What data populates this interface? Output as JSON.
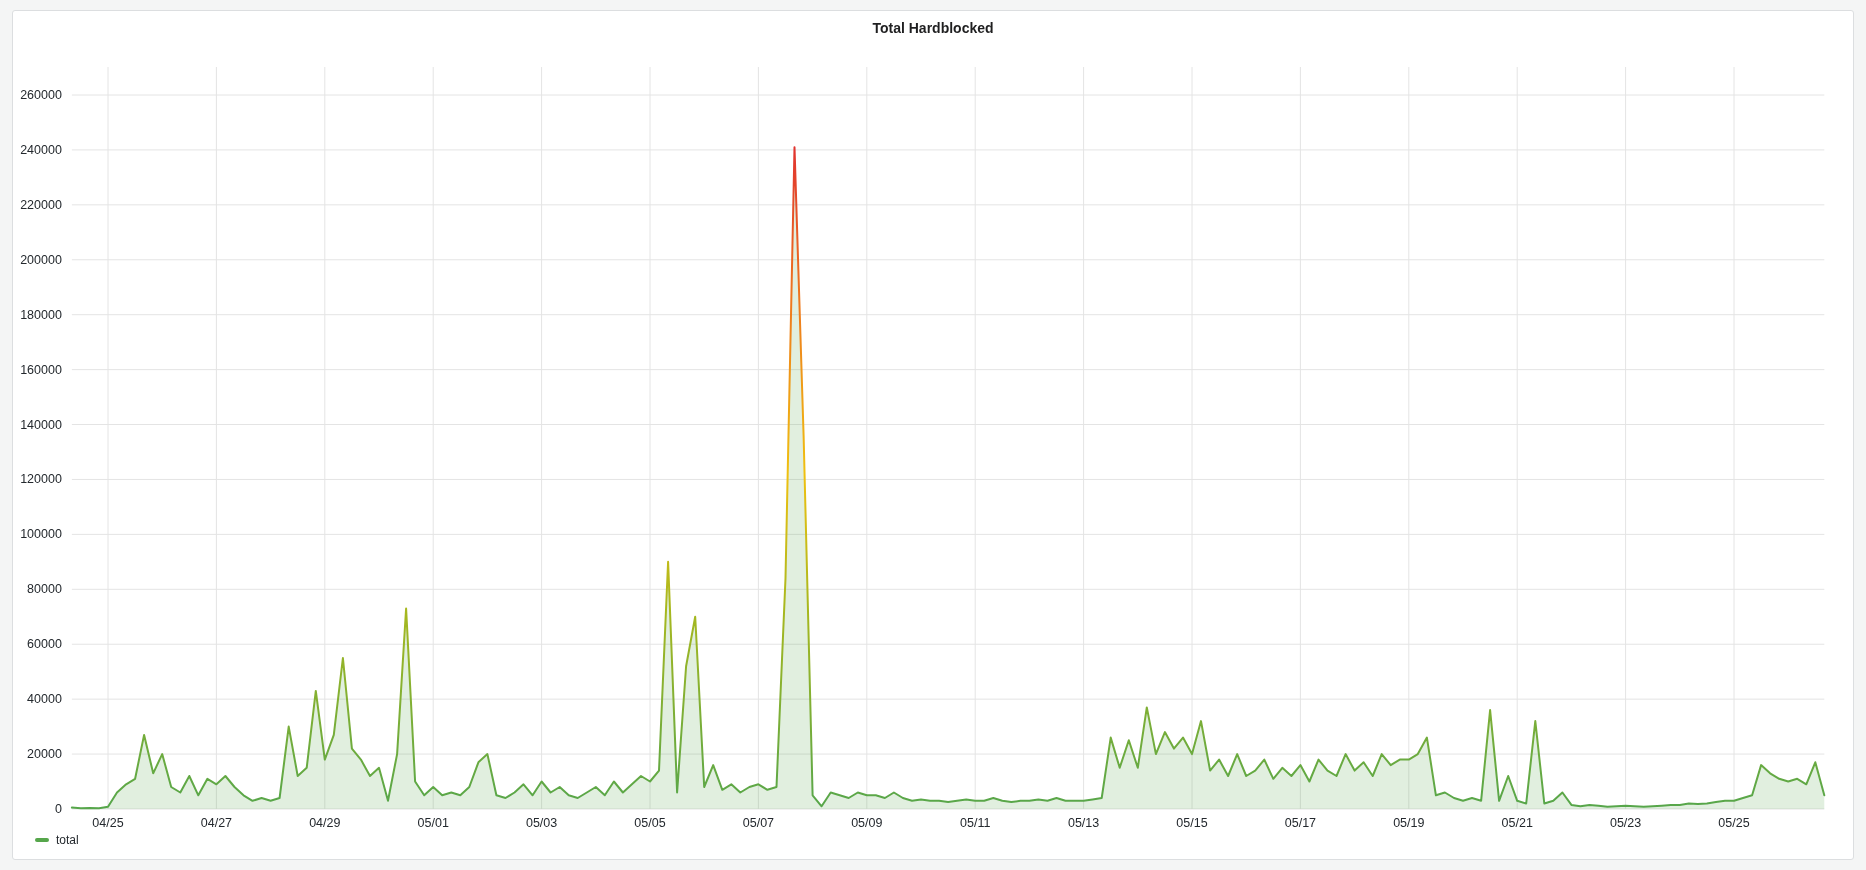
{
  "panel": {
    "title": "Total Hardblocked",
    "chart_data": {
      "type": "area",
      "grid": true,
      "ylim": [
        0,
        260000
      ],
      "yticks": [
        0,
        20000,
        40000,
        60000,
        80000,
        100000,
        120000,
        140000,
        160000,
        180000,
        200000,
        220000,
        240000,
        260000
      ],
      "categories": [
        null,
        null,
        null,
        null,
        "04/25",
        null,
        null,
        null,
        null,
        null,
        null,
        null,
        null,
        null,
        null,
        null,
        "04/27",
        null,
        null,
        null,
        null,
        null,
        null,
        null,
        null,
        null,
        null,
        null,
        "04/29",
        null,
        null,
        null,
        null,
        null,
        null,
        null,
        null,
        null,
        null,
        null,
        "05/01",
        null,
        null,
        null,
        null,
        null,
        null,
        null,
        null,
        null,
        null,
        null,
        "05/03",
        null,
        null,
        null,
        null,
        null,
        null,
        null,
        null,
        null,
        null,
        null,
        "05/05",
        null,
        null,
        null,
        null,
        null,
        null,
        null,
        null,
        null,
        null,
        null,
        "05/07",
        null,
        null,
        null,
        null,
        null,
        null,
        null,
        null,
        null,
        null,
        null,
        "05/09",
        null,
        null,
        null,
        null,
        null,
        null,
        null,
        null,
        null,
        null,
        null,
        "05/11",
        null,
        null,
        null,
        null,
        null,
        null,
        null,
        null,
        null,
        null,
        null,
        "05/13",
        null,
        null,
        null,
        null,
        null,
        null,
        null,
        null,
        null,
        null,
        null,
        "05/15",
        null,
        null,
        null,
        null,
        null,
        null,
        null,
        null,
        null,
        null,
        null,
        "05/17",
        null,
        null,
        null,
        null,
        null,
        null,
        null,
        null,
        null,
        null,
        null,
        "05/19",
        null,
        null,
        null,
        null,
        null,
        null,
        null,
        null,
        null,
        null,
        null,
        "05/21",
        null,
        null,
        null,
        null,
        null,
        null,
        null,
        null,
        null,
        null,
        null,
        "05/23",
        null,
        null,
        null,
        null,
        null,
        null,
        null,
        null,
        null,
        null,
        null,
        "05/25",
        null,
        null,
        null,
        null,
        null,
        null,
        null,
        null,
        null,
        null
      ],
      "series": [
        {
          "name": "total",
          "color": "#56a64b",
          "values": [
            500,
            300,
            400,
            300,
            800,
            6000,
            9000,
            11000,
            27000,
            13000,
            20000,
            8000,
            6000,
            12000,
            5000,
            11000,
            9000,
            12000,
            8000,
            5000,
            3000,
            4000,
            3000,
            4000,
            30000,
            12000,
            15000,
            43000,
            18000,
            27000,
            55000,
            22000,
            18000,
            12000,
            15000,
            3000,
            20000,
            73000,
            10000,
            5000,
            8000,
            5000,
            6000,
            5000,
            8000,
            17000,
            20000,
            5000,
            4000,
            6000,
            9000,
            5000,
            10000,
            6000,
            8000,
            5000,
            4000,
            6000,
            8000,
            5000,
            10000,
            6000,
            9000,
            12000,
            10000,
            14000,
            90000,
            6000,
            52000,
            70000,
            8000,
            16000,
            7000,
            9000,
            6000,
            8000,
            9000,
            7000,
            8000,
            84000,
            241000,
            136000,
            5000,
            1000,
            6000,
            5000,
            4000,
            6000,
            5000,
            5000,
            4000,
            6000,
            4000,
            3000,
            3500,
            3000,
            3000,
            2500,
            3000,
            3500,
            3000,
            3000,
            4000,
            3000,
            2500,
            3000,
            3000,
            3500,
            3000,
            4000,
            3000,
            3000,
            3000,
            3500,
            4000,
            26000,
            15000,
            25000,
            15000,
            37000,
            20000,
            28000,
            22000,
            26000,
            20000,
            32000,
            14000,
            18000,
            12000,
            20000,
            12000,
            14000,
            18000,
            11000,
            15000,
            12000,
            16000,
            10000,
            18000,
            14000,
            12000,
            20000,
            14000,
            17000,
            12000,
            20000,
            16000,
            18000,
            18000,
            20000,
            26000,
            5000,
            6000,
            4000,
            3000,
            4000,
            3000,
            36000,
            3000,
            12000,
            3000,
            2000,
            32000,
            2000,
            3000,
            6000,
            1500,
            1000,
            1500,
            1200,
            800,
            1000,
            1200,
            1000,
            800,
            1000,
            1200,
            1500,
            1500,
            2000,
            1800,
            2000,
            2500,
            3000,
            3000,
            4000,
            5000,
            16000,
            13000,
            11000,
            10000,
            11000,
            9000,
            17000,
            5000
          ]
        }
      ]
    }
  }
}
